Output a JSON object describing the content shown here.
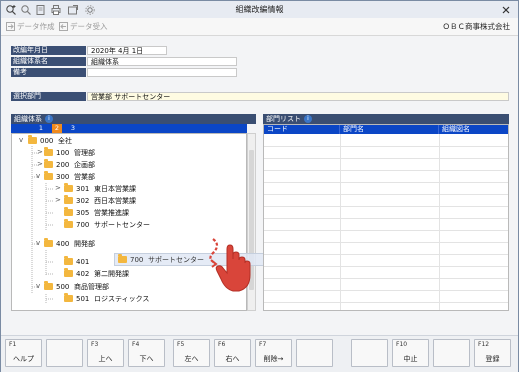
{
  "window": {
    "title": "組織改編情報"
  },
  "menubar": {
    "data_create": "データ作成",
    "data_receive": "データ受入",
    "company": "ＯＢＣ商事株式会社"
  },
  "fields": {
    "date_label": "改編年月日",
    "date_value": "2020年 4月 1日",
    "system_label": "組織体系名",
    "system_value": "組織体系",
    "note_label": "備考",
    "note_value": "",
    "dept_label": "選択部門",
    "dept_value": "営業部 サポートセンター"
  },
  "tree_panel": {
    "header": "組織体系",
    "info_icon": "i",
    "tabs": [
      "1",
      "2",
      "3"
    ],
    "active_tab": "2"
  },
  "tree_nodes": [
    {
      "code": "000",
      "name": "全社"
    },
    {
      "code": "100",
      "name": "管理部"
    },
    {
      "code": "200",
      "name": "企画部"
    },
    {
      "code": "300",
      "name": "営業部"
    },
    {
      "code": "301",
      "name": "東日本営業課"
    },
    {
      "code": "302",
      "name": "西日本営業課"
    },
    {
      "code": "305",
      "name": "営業推進課"
    },
    {
      "code": "700",
      "name": "サポートセンター"
    },
    {
      "code": "400",
      "name": "開発部"
    },
    {
      "code": "401",
      "name": ""
    },
    {
      "code": "402",
      "name": "第二開発課"
    },
    {
      "code": "500",
      "name": "商品管理部"
    },
    {
      "code": "501",
      "name": "ロジスティックス"
    }
  ],
  "drag_ghost": {
    "code": "700",
    "name": "サポートセンター"
  },
  "dept_list": {
    "header": "部門リスト",
    "info_icon": "i",
    "columns": [
      "コード",
      "部門名",
      "組織図名"
    ]
  },
  "fkeys": [
    {
      "key": "F1",
      "label": "ヘルプ"
    },
    {
      "key": "",
      "label": ""
    },
    {
      "key": "F3",
      "label": "上へ"
    },
    {
      "key": "F4",
      "label": "下へ"
    },
    {
      "key": "F5",
      "label": "左へ"
    },
    {
      "key": "F6",
      "label": "右へ"
    },
    {
      "key": "F7",
      "label": "削除→"
    },
    {
      "key": "",
      "label": ""
    },
    {
      "key": "",
      "label": ""
    },
    {
      "key": "F10",
      "label": "中止"
    },
    {
      "key": "",
      "label": ""
    },
    {
      "key": "F12",
      "label": "登録"
    }
  ],
  "colors": {
    "header_navy": "#3a4e72",
    "tab_blue": "#0b46c6",
    "active_tab": "#f08a1c",
    "folder": "#f3b73f",
    "hand": "#d9453a"
  }
}
